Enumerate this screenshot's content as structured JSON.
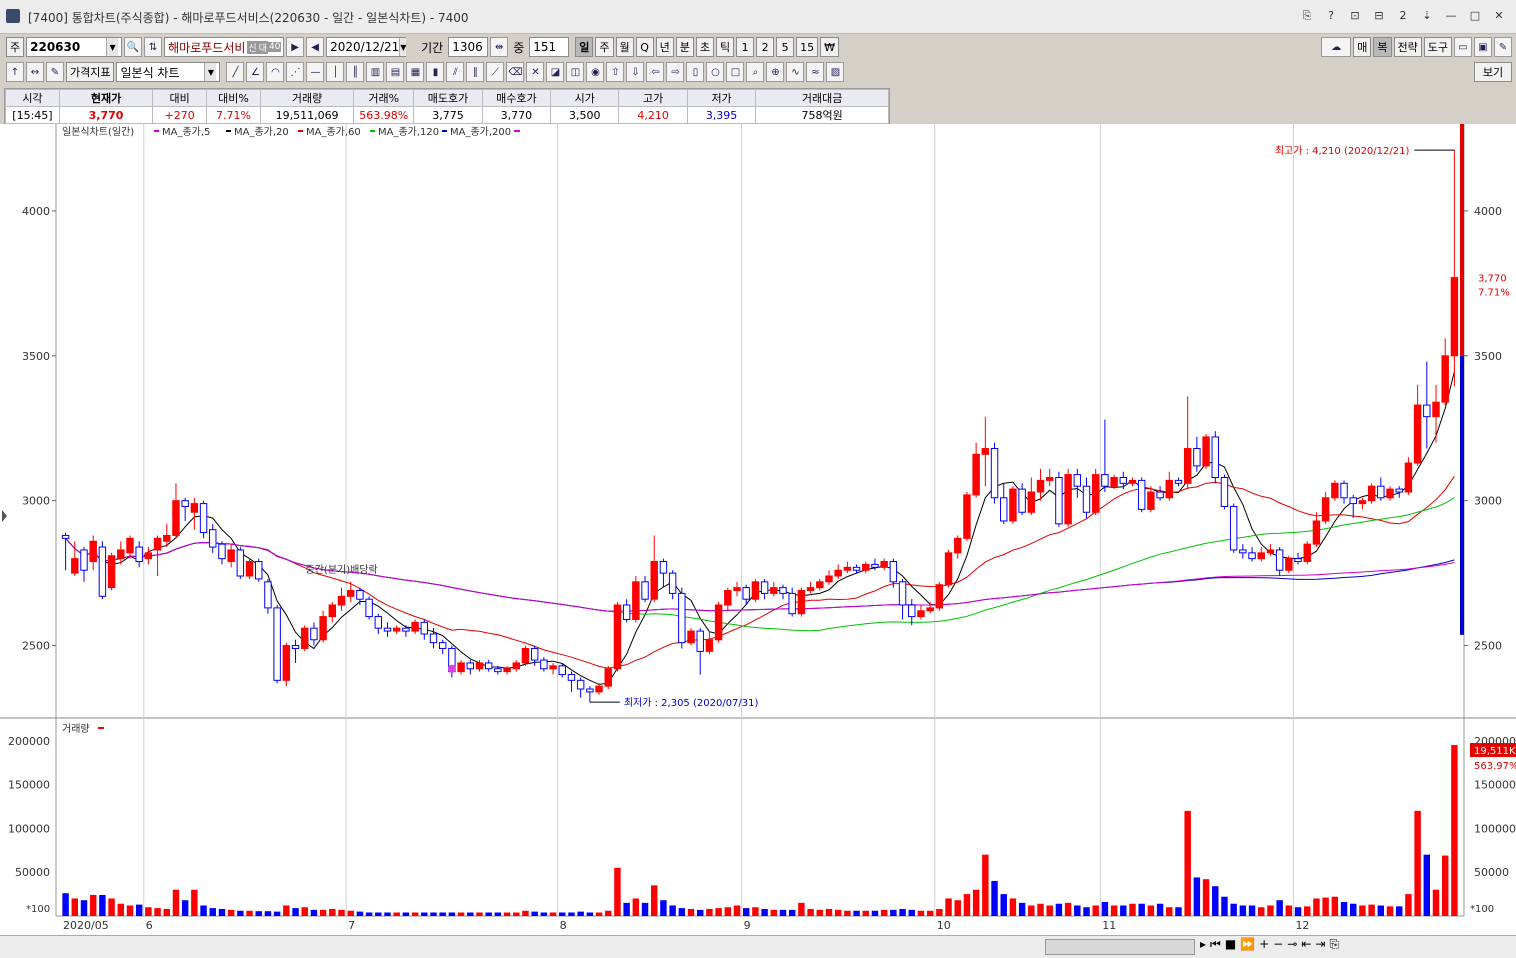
{
  "window": {
    "title": "[7400] 통합차트(주식종합) - 해마로푸드서비스(220630 - 일간 - 일본식차트) - 7400",
    "buttons": [
      "⎘",
      "?",
      "⊡",
      "⊟",
      "2",
      "⇣",
      "—",
      "□",
      "✕"
    ]
  },
  "toolbar1": {
    "market": "주",
    "code": "220630",
    "name": "해마로푸드서비",
    "name_badges": [
      "신",
      "대",
      "40"
    ],
    "date": "2020/12/21",
    "period_label": "기간",
    "period_value": "1306",
    "middle_label": "중",
    "middle_value": "151",
    "intervals": [
      "일",
      "주",
      "월",
      "Q",
      "년",
      "분",
      "초",
      "틱",
      "1",
      "2",
      "5",
      "15",
      "₩"
    ],
    "selected_interval": "일",
    "right_buttons": [
      "매",
      "복",
      "전략",
      "도구"
    ]
  },
  "toolbar2": {
    "indicator_label": "가격지표",
    "chart_type": "일본식 차트",
    "view_button": "보기"
  },
  "quote": {
    "headers": [
      "시각",
      "현재가",
      "대비",
      "대비%",
      "거래량",
      "거래%",
      "매도호가",
      "매수호가",
      "시가",
      "고가",
      "저가",
      "거래대금"
    ],
    "values": [
      "[15:45]",
      "3,770",
      "+270",
      "7.71%",
      "19,511,069",
      "563.98%",
      "3,775",
      "3,770",
      "3,500",
      "4,210",
      "3,395",
      "758억원"
    ]
  },
  "chart_data": {
    "type": "candlestick",
    "legend_title": "일본식차트(일간)",
    "ma_labels": [
      "MA_종가,5",
      "MA_종가,20",
      "MA_종가,60",
      "MA_종가,120",
      "MA_종가,200"
    ],
    "ma_colors": [
      "#000000",
      "#e00000",
      "#00c000",
      "#0000c0",
      "#d000d0"
    ],
    "price_ylim": [
      2250,
      4300
    ],
    "price_ticks": [
      2500,
      3000,
      3500,
      4000
    ],
    "volume_ylim": [
      0,
      210000
    ],
    "volume_ticks": [
      50000,
      100000,
      150000,
      200000
    ],
    "volume_legend": "거래량",
    "x_labels": [
      {
        "label": "2020/05",
        "index": 0
      },
      {
        "label": "6",
        "index": 9
      },
      {
        "label": "7",
        "index": 31
      },
      {
        "label": "8",
        "index": 54
      },
      {
        "label": "9",
        "index": 74
      },
      {
        "label": "10",
        "index": 95
      },
      {
        "label": "11",
        "index": 113
      },
      {
        "label": "12",
        "index": 134
      }
    ],
    "high_annotation": "최고가 : 4,210 (2020/12/21)",
    "low_annotation": "최저가 : 2,305 (2020/07/31)",
    "dividend_annotation": "중간(분기)배당락",
    "current_price_label": "3,770",
    "current_change_label": "7.71%",
    "current_volume_label": "19,511K",
    "current_volume_pct": "563.97%",
    "scale_note": "*100",
    "candles": [
      [
        2880,
        2870,
        2760,
        2890,
        260
      ],
      [
        2750,
        2800,
        2740,
        2860,
        200
      ],
      [
        2830,
        2760,
        2720,
        2840,
        180
      ],
      [
        2790,
        2860,
        2760,
        2880,
        240
      ],
      [
        2840,
        2670,
        2660,
        2860,
        240
      ],
      [
        2700,
        2810,
        2690,
        2820,
        200
      ],
      [
        2800,
        2830,
        2780,
        2860,
        140
      ],
      [
        2820,
        2870,
        2800,
        2880,
        120
      ],
      [
        2840,
        2790,
        2770,
        2860,
        130
      ],
      [
        2800,
        2820,
        2780,
        2840,
        100
      ],
      [
        2830,
        2870,
        2740,
        2880,
        90
      ],
      [
        2860,
        2880,
        2840,
        2920,
        80
      ],
      [
        2880,
        3000,
        2870,
        3060,
        300
      ],
      [
        3000,
        2980,
        2930,
        3010,
        180
      ],
      [
        2960,
        2990,
        2900,
        3010,
        300
      ],
      [
        2990,
        2890,
        2870,
        3000,
        120
      ],
      [
        2900,
        2840,
        2820,
        2920,
        90
      ],
      [
        2850,
        2800,
        2780,
        2860,
        80
      ],
      [
        2790,
        2830,
        2770,
        2850,
        70
      ],
      [
        2830,
        2740,
        2730,
        2840,
        60
      ],
      [
        2740,
        2790,
        2730,
        2800,
        60
      ],
      [
        2790,
        2730,
        2720,
        2800,
        55
      ],
      [
        2720,
        2630,
        2610,
        2730,
        55
      ],
      [
        2630,
        2380,
        2370,
        2640,
        50
      ],
      [
        2380,
        2500,
        2360,
        2510,
        120
      ],
      [
        2500,
        2490,
        2440,
        2520,
        90
      ],
      [
        2490,
        2560,
        2480,
        2570,
        100
      ],
      [
        2560,
        2520,
        2500,
        2580,
        70
      ],
      [
        2520,
        2600,
        2510,
        2620,
        70
      ],
      [
        2600,
        2640,
        2580,
        2650,
        80
      ],
      [
        2640,
        2670,
        2620,
        2700,
        70
      ],
      [
        2670,
        2690,
        2650,
        2720,
        60
      ],
      [
        2690,
        2660,
        2640,
        2700,
        50
      ],
      [
        2660,
        2600,
        2590,
        2670,
        40
      ],
      [
        2600,
        2560,
        2540,
        2610,
        40
      ],
      [
        2560,
        2550,
        2530,
        2580,
        40
      ],
      [
        2550,
        2560,
        2540,
        2570,
        40
      ],
      [
        2560,
        2550,
        2530,
        2570,
        40
      ],
      [
        2550,
        2580,
        2540,
        2590,
        40
      ],
      [
        2580,
        2540,
        2520,
        2590,
        40
      ],
      [
        2540,
        2510,
        2490,
        2560,
        40
      ],
      [
        2510,
        2490,
        2470,
        2520,
        40
      ],
      [
        2490,
        2410,
        2390,
        2500,
        40
      ],
      [
        2410,
        2440,
        2400,
        2450,
        40
      ],
      [
        2440,
        2420,
        2400,
        2450,
        40
      ],
      [
        2420,
        2440,
        2410,
        2450,
        40
      ],
      [
        2440,
        2420,
        2410,
        2450,
        40
      ],
      [
        2420,
        2410,
        2400,
        2430,
        40
      ],
      [
        2410,
        2420,
        2400,
        2430,
        40
      ],
      [
        2420,
        2440,
        2410,
        2450,
        40
      ],
      [
        2440,
        2490,
        2430,
        2500,
        60
      ],
      [
        2490,
        2450,
        2430,
        2500,
        50
      ],
      [
        2450,
        2420,
        2410,
        2460,
        40
      ],
      [
        2420,
        2430,
        2400,
        2440,
        40
      ],
      [
        2430,
        2400,
        2390,
        2440,
        40
      ],
      [
        2400,
        2380,
        2340,
        2410,
        40
      ],
      [
        2380,
        2350,
        2320,
        2390,
        50
      ],
      [
        2350,
        2340,
        2305,
        2360,
        40
      ],
      [
        2340,
        2360,
        2330,
        2370,
        40
      ],
      [
        2360,
        2420,
        2350,
        2430,
        60
      ],
      [
        2420,
        2640,
        2410,
        2650,
        550
      ],
      [
        2640,
        2590,
        2580,
        2660,
        150
      ],
      [
        2590,
        2720,
        2580,
        2740,
        200
      ],
      [
        2720,
        2660,
        2650,
        2740,
        150
      ],
      [
        2660,
        2790,
        2650,
        2880,
        350
      ],
      [
        2790,
        2750,
        2700,
        2800,
        180
      ],
      [
        2750,
        2680,
        2660,
        2760,
        120
      ],
      [
        2680,
        2510,
        2490,
        2700,
        90
      ],
      [
        2510,
        2550,
        2500,
        2560,
        80
      ],
      [
        2550,
        2480,
        2400,
        2560,
        70
      ],
      [
        2480,
        2520,
        2470,
        2550,
        80
      ],
      [
        2520,
        2640,
        2510,
        2650,
        90
      ],
      [
        2640,
        2690,
        2620,
        2700,
        100
      ],
      [
        2690,
        2700,
        2670,
        2720,
        120
      ],
      [
        2700,
        2660,
        2640,
        2710,
        90
      ],
      [
        2660,
        2720,
        2650,
        2730,
        100
      ],
      [
        2720,
        2680,
        2660,
        2730,
        80
      ],
      [
        2680,
        2700,
        2670,
        2720,
        70
      ],
      [
        2700,
        2680,
        2660,
        2710,
        70
      ],
      [
        2680,
        2610,
        2600,
        2700,
        70
      ],
      [
        2610,
        2690,
        2600,
        2700,
        150
      ],
      [
        2690,
        2700,
        2680,
        2720,
        80
      ],
      [
        2700,
        2720,
        2690,
        2730,
        70
      ],
      [
        2720,
        2740,
        2710,
        2760,
        80
      ],
      [
        2740,
        2760,
        2730,
        2780,
        70
      ],
      [
        2760,
        2770,
        2750,
        2790,
        60
      ],
      [
        2770,
        2760,
        2750,
        2780,
        60
      ],
      [
        2760,
        2780,
        2750,
        2790,
        60
      ],
      [
        2780,
        2770,
        2760,
        2800,
        60
      ],
      [
        2770,
        2790,
        2760,
        2800,
        70
      ],
      [
        2790,
        2720,
        2700,
        2800,
        70
      ],
      [
        2720,
        2640,
        2590,
        2730,
        80
      ],
      [
        2640,
        2600,
        2570,
        2660,
        70
      ],
      [
        2600,
        2620,
        2590,
        2640,
        60
      ],
      [
        2620,
        2630,
        2610,
        2650,
        60
      ],
      [
        2630,
        2710,
        2620,
        2720,
        80
      ],
      [
        2710,
        2820,
        2700,
        2830,
        200
      ],
      [
        2820,
        2870,
        2800,
        2880,
        180
      ],
      [
        2870,
        3020,
        2860,
        3030,
        250
      ],
      [
        3020,
        3160,
        3010,
        3200,
        300
      ],
      [
        3160,
        3180,
        3050,
        3290,
        700
      ],
      [
        3180,
        3010,
        2990,
        3200,
        400
      ],
      [
        3010,
        2930,
        2920,
        3060,
        250
      ],
      [
        2930,
        3040,
        2920,
        3050,
        200
      ],
      [
        3040,
        2960,
        2950,
        3060,
        150
      ],
      [
        2960,
        3030,
        2950,
        3080,
        120
      ],
      [
        3030,
        3070,
        3000,
        3110,
        140
      ],
      [
        3070,
        3080,
        3050,
        3110,
        120
      ],
      [
        3080,
        2920,
        2910,
        3100,
        140
      ],
      [
        2920,
        3090,
        2910,
        3110,
        150
      ],
      [
        3090,
        3050,
        3010,
        3110,
        120
      ],
      [
        3050,
        2960,
        2940,
        3080,
        100
      ],
      [
        2960,
        3090,
        2950,
        3110,
        120
      ],
      [
        3090,
        3050,
        3030,
        3280,
        160
      ],
      [
        3050,
        3080,
        3040,
        3090,
        120
      ],
      [
        3080,
        3060,
        3040,
        3100,
        120
      ],
      [
        3060,
        3070,
        3050,
        3080,
        140
      ],
      [
        3070,
        2970,
        2960,
        3080,
        140
      ],
      [
        2970,
        3030,
        2960,
        3050,
        120
      ],
      [
        3030,
        3010,
        3000,
        3050,
        140
      ],
      [
        3010,
        3070,
        3000,
        3100,
        100
      ],
      [
        3070,
        3060,
        3050,
        3080,
        100
      ],
      [
        3060,
        3180,
        3040,
        3360,
        1200
      ],
      [
        3180,
        3120,
        3100,
        3220,
        440
      ],
      [
        3120,
        3220,
        3110,
        3230,
        420
      ],
      [
        3220,
        3080,
        3060,
        3240,
        340
      ],
      [
        3080,
        2980,
        2970,
        3090,
        220
      ],
      [
        2980,
        2830,
        2820,
        2990,
        140
      ],
      [
        2830,
        2820,
        2800,
        2850,
        120
      ],
      [
        2820,
        2800,
        2790,
        2840,
        120
      ],
      [
        2800,
        2820,
        2790,
        2840,
        100
      ],
      [
        2820,
        2830,
        2810,
        2850,
        120
      ],
      [
        2830,
        2760,
        2740,
        2840,
        180
      ],
      [
        2760,
        2800,
        2750,
        2810,
        120
      ],
      [
        2800,
        2790,
        2780,
        2820,
        100
      ],
      [
        2790,
        2850,
        2780,
        2860,
        110
      ],
      [
        2850,
        2930,
        2840,
        2960,
        200
      ],
      [
        2930,
        3010,
        2920,
        3030,
        210
      ],
      [
        3010,
        3060,
        3000,
        3070,
        220
      ],
      [
        3060,
        3010,
        2990,
        3070,
        160
      ],
      [
        3010,
        2990,
        2940,
        3020,
        140
      ],
      [
        2990,
        3000,
        2970,
        3010,
        120
      ],
      [
        3000,
        3050,
        2990,
        3060,
        130
      ],
      [
        3050,
        3010,
        3000,
        3080,
        120
      ],
      [
        3010,
        3040,
        3000,
        3050,
        110
      ],
      [
        3040,
        3030,
        3010,
        3050,
        110
      ],
      [
        3030,
        3130,
        3020,
        3150,
        250
      ],
      [
        3130,
        3330,
        3120,
        3400,
        1200
      ],
      [
        3330,
        3290,
        3180,
        3480,
        700
      ],
      [
        3290,
        3340,
        3200,
        3400,
        300
      ],
      [
        3340,
        3500,
        3330,
        3560,
        690
      ],
      [
        3500,
        3770,
        3395,
        4210,
        1951
      ]
    ]
  }
}
